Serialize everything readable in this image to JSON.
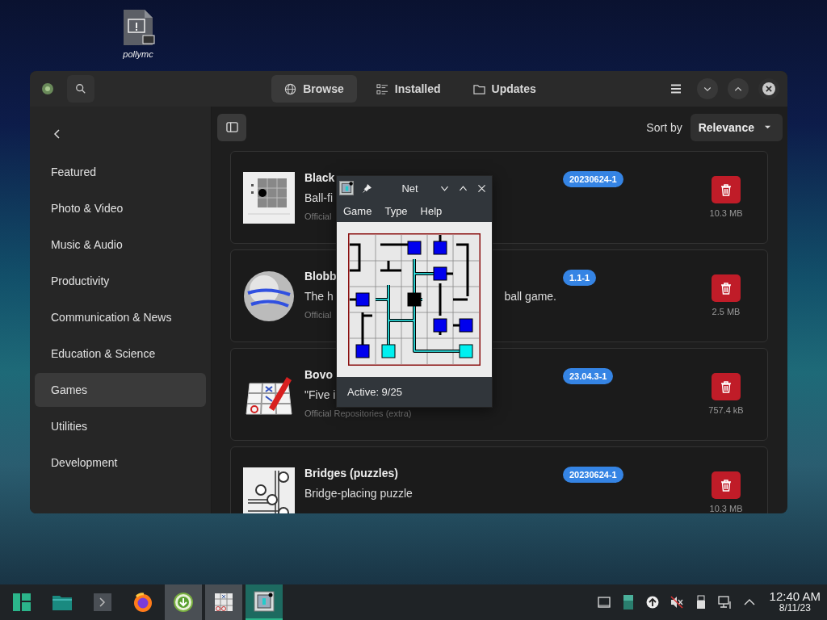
{
  "desktop": {
    "icons": [
      {
        "label": "pollymc"
      }
    ]
  },
  "app_window": {
    "tabs": [
      {
        "label": "Browse",
        "kind": "globe",
        "selected": true
      },
      {
        "label": "Installed",
        "kind": "list",
        "selected": false
      },
      {
        "label": "Updates",
        "kind": "folder",
        "selected": false
      }
    ],
    "sidebar": {
      "items": [
        {
          "label": "Featured",
          "selected": false
        },
        {
          "label": "Photo & Video",
          "selected": false
        },
        {
          "label": "Music & Audio",
          "selected": false
        },
        {
          "label": "Productivity",
          "selected": false
        },
        {
          "label": "Communication & News",
          "selected": false
        },
        {
          "label": "Education & Science",
          "selected": false
        },
        {
          "label": "Games",
          "selected": true
        },
        {
          "label": "Utilities",
          "selected": false
        },
        {
          "label": "Development",
          "selected": false
        }
      ]
    },
    "sort": {
      "label": "Sort by",
      "value": "Relevance"
    },
    "apps": [
      {
        "kind": "grid",
        "name": "Black",
        "description": [
          "Ball-fi"
        ],
        "source": "Official",
        "version": "20230624-1",
        "size": "10.3 MB"
      },
      {
        "kind": "ball",
        "name": "Blobb",
        "description": [
          "The h",
          "ball game."
        ],
        "source": "Official",
        "version": "1.1-1",
        "size": "2.5 MB"
      },
      {
        "kind": "tictactoe",
        "name": "Bovo",
        "description": [
          "\"Five i"
        ],
        "source": "Official Repositories (extra)",
        "version": "23.04.3-1",
        "size": "757.4 kB"
      },
      {
        "kind": "bridges",
        "name": "Bridges (puzzles)",
        "description": [
          "Bridge-placing puzzle"
        ],
        "version": "20230624-1",
        "size": "10.3 MB"
      }
    ]
  },
  "net_window": {
    "title": "Net",
    "menu": [
      "Game",
      "Type",
      "Help"
    ],
    "status": "Active: 9/25"
  },
  "taskbar": {
    "tasks": [
      {
        "kind": "manjaro",
        "running": false,
        "selected": false
      },
      {
        "kind": "files",
        "running": false,
        "selected": false
      },
      {
        "kind": "terminal",
        "running": false,
        "selected": false
      },
      {
        "kind": "firefox",
        "running": false,
        "selected": false
      },
      {
        "kind": "software",
        "running": true,
        "selected": false
      },
      {
        "kind": "tictactoe",
        "running": true,
        "selected": false
      },
      {
        "kind": "net",
        "running": true,
        "selected": true
      }
    ],
    "clock": {
      "time": "12:40 AM",
      "date": "8/11/23"
    }
  }
}
